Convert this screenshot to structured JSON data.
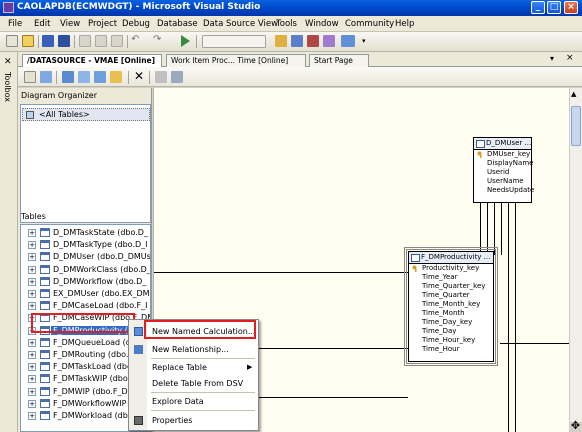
{
  "window": {
    "title": "CAOLAPDB(ECMWDGT) - Microsoft Visual Studio",
    "controls": [
      "minimize-icon",
      "maximize-icon",
      "close-icon"
    ]
  },
  "menubar": {
    "items": [
      "File",
      "Edit",
      "View",
      "Project",
      "Debug",
      "Database",
      "Data Source View",
      "Tools",
      "Window",
      "Community",
      "Help"
    ]
  },
  "toolbox": {
    "label": "Toolbox"
  },
  "tabs": [
    {
      "label": "/DATASOURCE - VMAE [Online]",
      "active": true
    },
    {
      "label": "Work Item Proc... Time [Online]",
      "active": false
    },
    {
      "label": "Start Page",
      "active": false
    }
  ],
  "left": {
    "organizer_header": "Diagram Organizer",
    "organizer_item": "<All Tables>",
    "tables_header": "Tables",
    "tables": [
      "D_DMTaskState (dbo.D_",
      "D_DMTaskType (dbo.D_I",
      "D_DMUser (dbo.D_DMUs",
      "D_DMWorkClass (dbo.D_",
      "D_DMWorkflow (dbo.D_",
      "EX_DMUser (dbo.EX_DM",
      "F_DMCaseLoad (dbo.F_I",
      "F_DMCaseWIP (dbo.F_DM",
      "F_DMProductivity (dbo",
      "F_DMQueueLoad (dbo.F",
      "F_DMRouting (dbo.F_D",
      "F_DMTaskLoad (dbo.F_",
      "F_DMTaskWIP (dbo.F_",
      "F_DMWIP (dbo.F_DM",
      "F_DMWorkflowWIP (dbo.",
      "F_DMWorkload (dbo.F_I"
    ],
    "selected_index": 8
  },
  "diagram": {
    "user_entity": {
      "title": "D_DMUser ...",
      "fields": [
        "DMUser_key",
        "DisplayName",
        "Userid",
        "UserName",
        "NeedsUpdate"
      ]
    },
    "productivity_entity": {
      "title": "F_DMProductivity ...",
      "fields": [
        "Productivity_key",
        "Time_Year",
        "Time_Quarter_key",
        "Time_Quarter",
        "Time_Month_key",
        "Time_Month",
        "Time_Day_key",
        "Time_Day",
        "Time_Hour_key",
        "Time_Hour"
      ]
    }
  },
  "context_menu": {
    "items": [
      {
        "label": "New Named Calculation...",
        "icon": "calc-icon"
      },
      {
        "label": "New Relationship...",
        "icon": "relationship-icon"
      },
      {
        "label": "Replace Table",
        "icon": "",
        "submenu": true
      },
      {
        "label": "Delete Table From DSV",
        "icon": ""
      },
      {
        "label": "Explore Data",
        "icon": ""
      },
      {
        "label": "Properties",
        "icon": "properties-icon"
      }
    ]
  },
  "colors": {
    "titlebar": "#0046c8",
    "selection": "#316ac5",
    "diagram_bg": "#fffdf0",
    "highlight_box": "#e02020"
  }
}
